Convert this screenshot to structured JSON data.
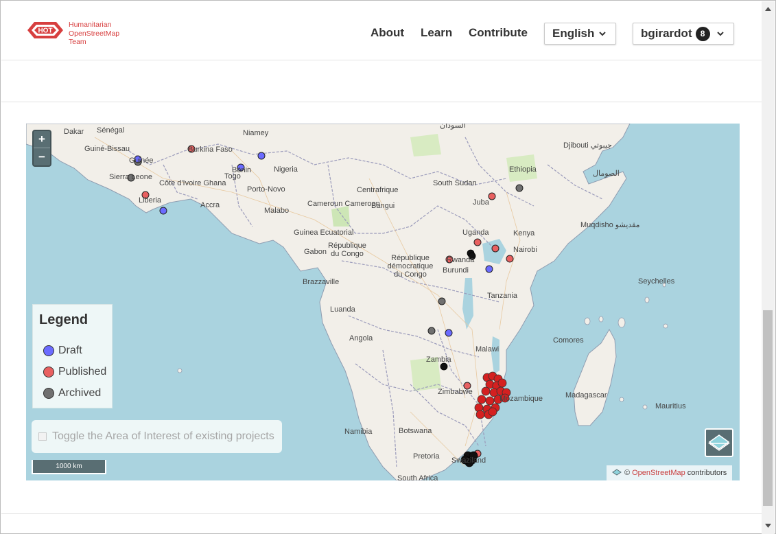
{
  "header": {
    "logo_badge": "HOT",
    "logo_text_line1": "Humanitarian",
    "logo_text_line2": "OpenStreetMap",
    "logo_text_line3": "Team",
    "nav": {
      "about": "About",
      "learn": "Learn",
      "contribute": "Contribute"
    },
    "language": "English",
    "user": {
      "name": "bgirardot",
      "notifications": "8"
    }
  },
  "map": {
    "zoom_in": "+",
    "zoom_out": "−",
    "legend": {
      "title": "Legend",
      "items": [
        {
          "label": "Draft",
          "color": "#6b6bff"
        },
        {
          "label": "Published",
          "color": "#e86060"
        },
        {
          "label": "Archived",
          "color": "#707070"
        }
      ]
    },
    "toggle_aoi_label": "Toggle the Area of Interest of existing projects",
    "scale_label": "1000 km",
    "attribution": {
      "copyright": "©",
      "link": "OpenStreetMap",
      "suffix": "contributors"
    },
    "labels": [
      "Dakar",
      "Sénégal",
      "Guiné-Bissau",
      "Guinée",
      "Sierra Leone",
      "Liberia",
      "Burkina Faso",
      "Niamey",
      "Bénin",
      "Togo",
      "Nigeria",
      "Côte d'Ivoire Ghana",
      "Accra",
      "Porto-Novo",
      "Malabo",
      "Cameroun Cameroon",
      "Bangui",
      "Centrafrique",
      "Guinea Ecuatorial",
      "Gabon",
      "République du Congo",
      "Brazzaville",
      "République démocratique du Congo",
      "Luanda",
      "Angola",
      "Zambia",
      "Namibia",
      "Botswana",
      "Zimbabwe",
      "Pretoria",
      "Swaziland",
      "South Africa",
      "South Sudan",
      "Juba",
      "Ethiopia",
      "Djibouti جيبوتي",
      "الصومال",
      "Muqdisho مقديشو",
      "Uganda",
      "Kenya",
      "Nairobi",
      "Rwanda",
      "Burundi",
      "Tanzania",
      "Malawi",
      "Mozambique",
      "Seychelles",
      "Comores",
      "Madagascar",
      "Mauritius",
      "السودان"
    ]
  }
}
